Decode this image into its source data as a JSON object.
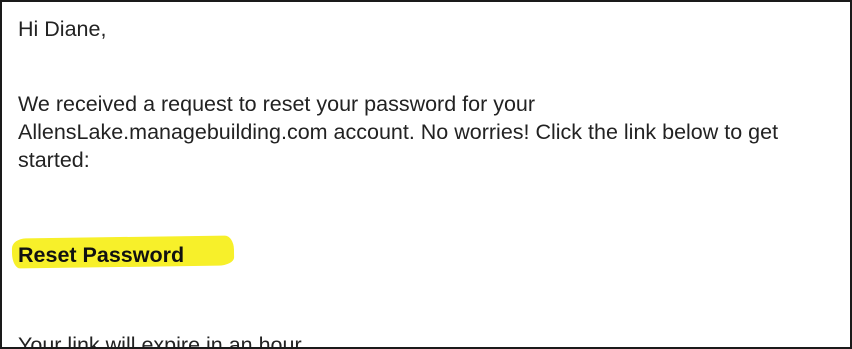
{
  "email": {
    "greeting": "Hi Diane,",
    "paragraph_lines": [
      "We received a request to reset your password for your",
      "AllensLake.managebuilding.com account. No worries! Click the link below to get",
      "started:"
    ],
    "reset_link_label": "Reset Password",
    "expiry_text": "Your link will expire in an hour."
  },
  "colors": {
    "highlight": "#f7f02a",
    "border": "#1a1a1a",
    "text": "#222222"
  }
}
